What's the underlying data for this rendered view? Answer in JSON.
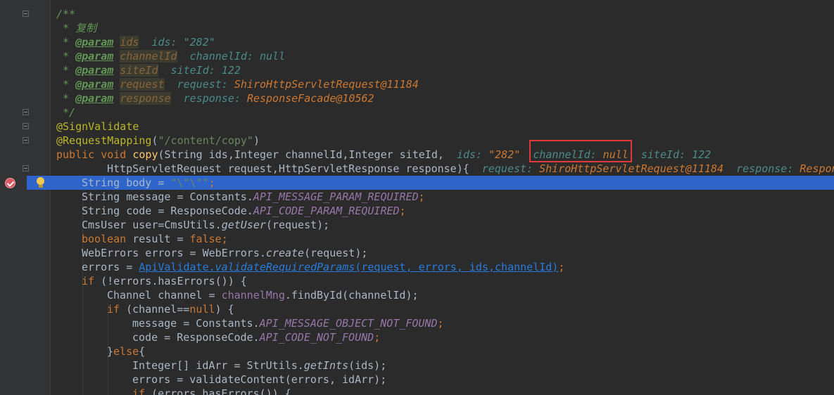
{
  "editor": {
    "language": "java",
    "highlight_color": "#2f65ca",
    "annotation_box_color": "#e03a3a",
    "gutter_icons": {
      "breakpoint": "breakpoint-check-icon",
      "intention": "lightbulb-icon",
      "fold": "fold-marker-icon"
    }
  },
  "lines": {
    "l1": "/**",
    "l2_prefix": " * ",
    "l2_text": "复制",
    "doc_star": " * ",
    "param_tag": "@param",
    "p1_name": "ids",
    "p1_hint_name": "ids:",
    "p1_hint_val": "\"282\"",
    "p2_name": "channelId",
    "p2_hint_name": "channelId:",
    "p2_hint_val": "null",
    "p3_name": "siteId",
    "p3_hint_name": "siteId:",
    "p3_hint_val": "122",
    "p4_name": "request",
    "p4_hint_name": "request:",
    "p4_hint_val": "ShiroHttpServletRequest@11184",
    "p5_name": "response",
    "p5_hint_name": "response:",
    "p5_hint_val": "ResponseFacade@10562",
    "l8": " */",
    "l9": "@SignValidate",
    "l10_ann": "@RequestMapping",
    "l10_open": "(",
    "l10_str": "\"/content/copy\"",
    "l10_close": ")",
    "l11_kw1": "public",
    "l11_kw2": "void",
    "l11_fn": "copy",
    "l11_rest": "(String ids,Integer channelId,Integer siteId,",
    "l11_h1_name": "ids:",
    "l11_h1_val": "\"282\"",
    "l11_h2_name": "channelId:",
    "l11_h2_val": "null",
    "l11_h3_name": "siteId:",
    "l11_h3_val": "122",
    "l12": "HttpServletRequest request,HttpServletResponse response){",
    "l12_h1_name": "request:",
    "l12_h1_val": "ShiroHttpServletRequest@11184",
    "l12_h2_name": "response:",
    "l12_h2_val": "Respon",
    "l13_a": "String body = ",
    "l13_str": "\"\\\"\\\"\"",
    "l13_b": ";",
    "l14_a": "String message = Constants.",
    "l14_const": "API_MESSAGE_PARAM_REQUIRED",
    "l14_b": ";",
    "l15_a": "String code = ResponseCode.",
    "l15_const": "API_CODE_PARAM_REQUIRED",
    "l15_b": ";",
    "l16_a": "CmsUser user=CmsUtils.",
    "l16_call": "getUser",
    "l16_b": "(request);",
    "l17_kw": "boolean",
    "l17_a": " result = ",
    "l17_kw2": "false",
    "l17_b": ";",
    "l18_a": "WebErrors errors = WebErrors.",
    "l18_call": "create",
    "l18_b": "(request);",
    "l19_a": "errors = ",
    "l19_link1": "ApiValidate.",
    "l19_link2": "validateRequiredParams",
    "l19_link3": "(request, errors, ids,channelId)",
    "l19_b": ";",
    "l20_kw": "if",
    "l20_a": " (!errors.hasErrors()) {",
    "l21_a": "Channel channel = ",
    "l21_field": "channelMng",
    "l21_b": ".findById(channelId);",
    "l22_kw": "if",
    "l22_a": " (channel==",
    "l22_kw2": "null",
    "l22_b": ") {",
    "l23_a": "message = Constants.",
    "l23_const": "API_MESSAGE_OBJECT_NOT_FOUND",
    "l23_b": ";",
    "l24_a": "code = ResponseCode.",
    "l24_const": "API_CODE_NOT_FOUND",
    "l24_b": ";",
    "l25_a": "}",
    "l25_kw": "else",
    "l25_b": "{",
    "l26_a": "Integer[] idArr = StrUtils.",
    "l26_call": "getInts",
    "l26_b": "(ids);",
    "l27_a": "errors = validateContent(errors, idArr);",
    "l28_kw": "if",
    "l28_a": " (errors.hasErrors()) {"
  }
}
